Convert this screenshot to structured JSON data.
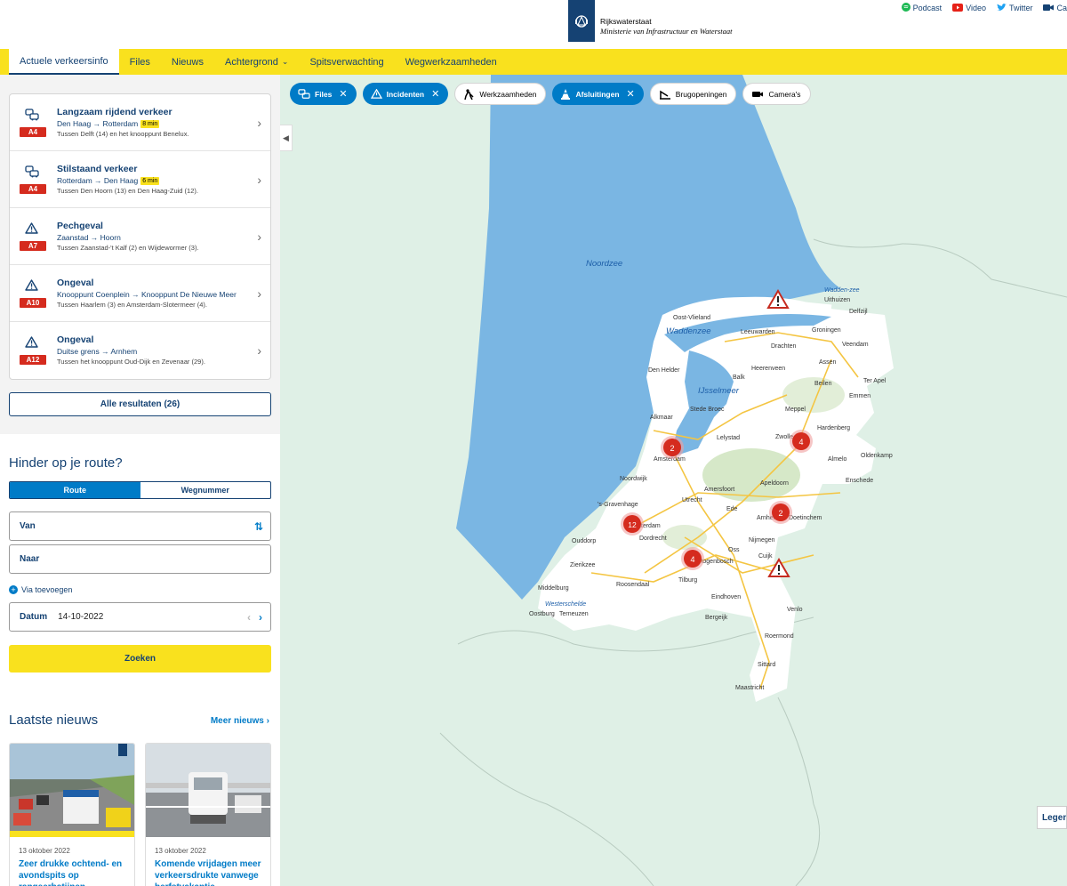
{
  "brand": {
    "name": "Rijkswaterstaat",
    "subtitle": "Ministerie van Infrastructuur en Waterstaat"
  },
  "social": [
    {
      "label": "Podcast",
      "icon": "spotify-icon"
    },
    {
      "label": "Video",
      "icon": "youtube-icon"
    },
    {
      "label": "Twitter",
      "icon": "twitter-icon"
    },
    {
      "label": "Ca",
      "icon": "camera-icon"
    }
  ],
  "nav": {
    "items": [
      {
        "label": "Actuele verkeersinfo",
        "active": true
      },
      {
        "label": "Files"
      },
      {
        "label": "Nieuws"
      },
      {
        "label": "Achtergrond",
        "dropdown": true
      },
      {
        "label": "Spitsverwachting"
      },
      {
        "label": "Wegwerkzaamheden"
      }
    ]
  },
  "incidents": [
    {
      "icon": "traffic-jam-icon",
      "road": "A4",
      "title": "Langzaam rijdend verkeer",
      "direction": "Den Haag → Rotterdam",
      "duration": "8 min",
      "description": "Tussen Delft (14) en het knooppunt Benelux."
    },
    {
      "icon": "traffic-jam-icon",
      "road": "A4",
      "title": "Stilstaand verkeer",
      "direction": "Rotterdam → Den Haag",
      "duration": "6 min",
      "description": "Tussen Den Hoorn (13) en Den Haag-Zuid (12)."
    },
    {
      "icon": "warning-icon",
      "road": "A7",
      "title": "Pechgeval",
      "direction": "Zaanstad → Hoorn",
      "duration": "",
      "description": "Tussen Zaanstad-'t Kalf (2) en Wijdewormer (3)."
    },
    {
      "icon": "warning-icon",
      "road": "A10",
      "title": "Ongeval",
      "direction": "Knooppunt Coenplein → Knooppunt De Nieuwe Meer",
      "duration": "",
      "description": "Tussen Haarlem (3) en Amsterdam-Slotermeer (4)."
    },
    {
      "icon": "warning-icon",
      "road": "A12",
      "title": "Ongeval",
      "direction": "Duitse grens → Arnhem",
      "duration": "",
      "description": "Tussen het knooppunt Oud-Dijk en Zevenaar (29)."
    }
  ],
  "all_results": "Alle resultaten (26)",
  "route": {
    "title": "Hinder op je route?",
    "tabs": [
      "Route",
      "Wegnummer"
    ],
    "from_placeholder": "Van",
    "to_placeholder": "Naar",
    "via": "Via toevoegen",
    "date_label": "Datum",
    "date_value": "14-10-2022",
    "search": "Zoeken"
  },
  "news": {
    "title": "Laatste nieuws",
    "more": "Meer nieuws",
    "cards": [
      {
        "date": "13 oktober 2022",
        "headline": "Zeer drukke ochtend- en avondspits op rangeerbatijnen donderdag"
      },
      {
        "date": "13 oktober 2022",
        "headline": "Komende vrijdagen meer verkeersdrukte vanwege herfstvakantie"
      }
    ]
  },
  "filters": [
    {
      "label": "Files",
      "active": true,
      "icon": "traffic-jam-icon"
    },
    {
      "label": "Incidenten",
      "active": true,
      "icon": "warning-icon"
    },
    {
      "label": "Werkzaamheden",
      "active": false,
      "icon": "roadwork-icon"
    },
    {
      "label": "Afsluitingen",
      "active": true,
      "icon": "closure-icon"
    },
    {
      "label": "Brugopeningen",
      "active": false,
      "icon": "bridge-icon"
    },
    {
      "label": "Camera's",
      "active": false,
      "icon": "camera-icon"
    }
  ],
  "map": {
    "sea_labels": [
      "Noordzee",
      "Waddenzee",
      "IJsselmeer",
      "Wadden-zee",
      "Westerschelde"
    ],
    "cities": [
      "Oost-Vlieland",
      "Leeuwarden",
      "Groningen",
      "Uithuizen",
      "Delfzijl",
      "Drachten",
      "Veendam",
      "Heerenveen",
      "Assen",
      "Den Helder",
      "Balk",
      "Beilen",
      "Emmen",
      "Ter Apel",
      "Stede Broec",
      "Meppel",
      "Alkmaar",
      "Lelystad",
      "Zwolle",
      "Hardenberg",
      "Amsterdam",
      "Almelo",
      "Enschede",
      "Oldenkamp",
      "Noordwijk",
      "Amersfoort",
      "Apeldoorn",
      "'s-Gravenhage",
      "Utrecht",
      "Ede",
      "Arnhem",
      "Doetinchem",
      "Rotterdam",
      "Dordrecht",
      "Nijmegen",
      "Ouddorp",
      "Oss",
      "Cuijk",
      "Zierikzee",
      "'s-Hertogenbosch",
      "Roosendaal",
      "Tilburg",
      "Middelburg",
      "Eindhoven",
      "Venlo",
      "Oostburg",
      "Terneuzen",
      "Bergeijk",
      "Roermond",
      "Sittard",
      "Maastricht"
    ],
    "clusters": [
      "2",
      "4",
      "12",
      "2",
      "4"
    ],
    "legend": "Legenda"
  },
  "colors": {
    "brand_blue": "#154273",
    "accent_yellow": "#f9e11e",
    "link_blue": "#007bc7",
    "incident_red": "#d52b1e",
    "sea": "#7ab6e3",
    "land": "#ffffff",
    "map_bg": "#dff0e6"
  }
}
